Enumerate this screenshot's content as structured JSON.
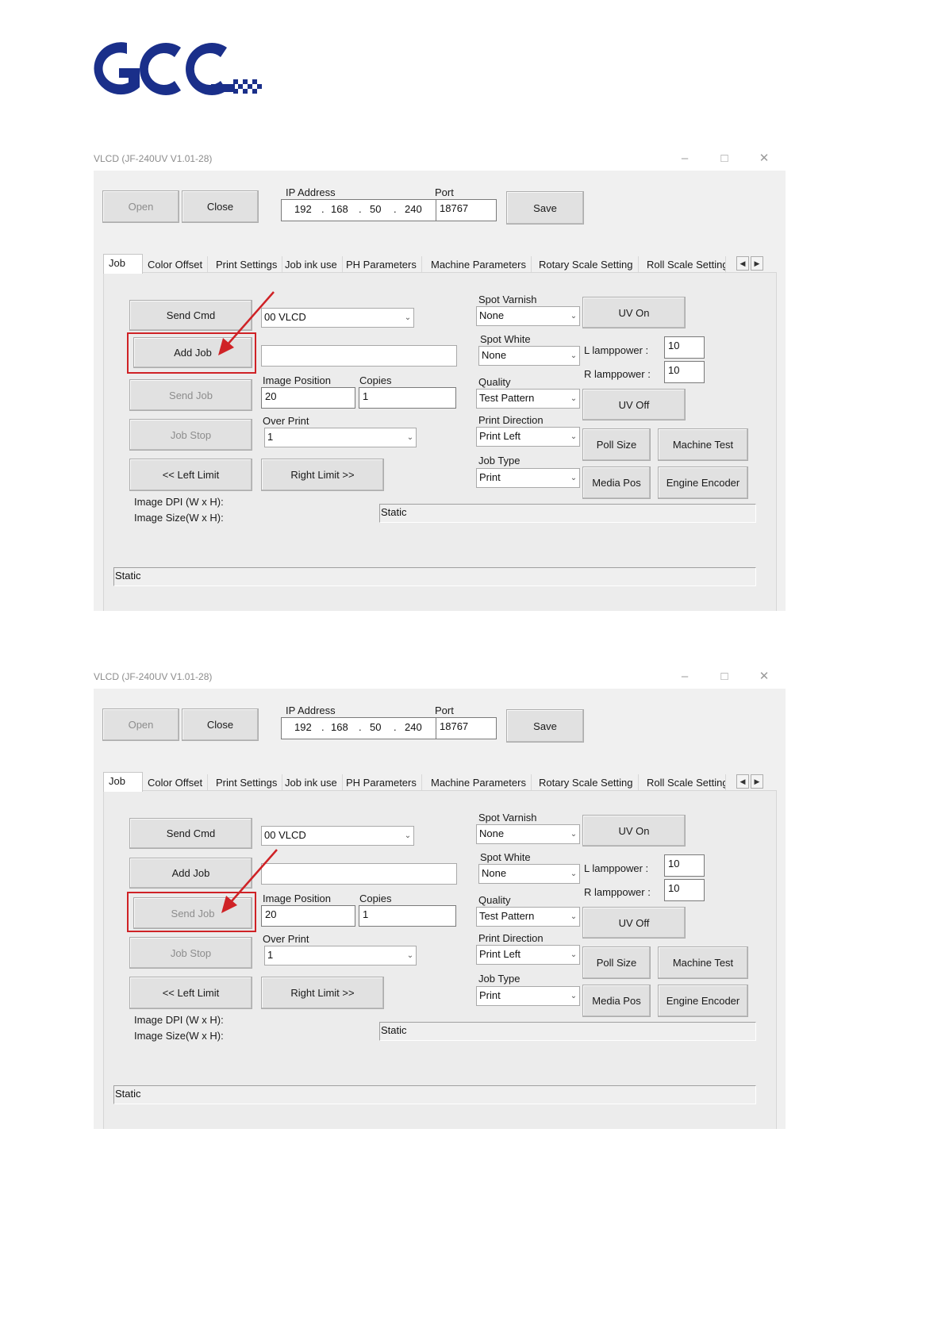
{
  "logo": {
    "text": "GCC",
    "color": "#1a2f8a"
  },
  "screens": [
    {
      "title": "VLCD (JF-240UV V1.01-28)",
      "highlighted_button": "add-job",
      "ip_address": {
        "label": "IP Address",
        "octets": [
          "192",
          "168",
          "50",
          "240"
        ]
      },
      "port": {
        "label": "Port",
        "value": "18767"
      },
      "buttons": {
        "open": "Open",
        "close": "Close",
        "save": "Save"
      },
      "tabs": [
        "Job",
        "Color Offset",
        "Print Settings",
        "Job ink use",
        "PH Parameters",
        "Machine Parameters",
        "Rotary Scale Setting",
        "Roll Scale Setting"
      ],
      "job": {
        "send_cmd": "Send Cmd",
        "cmd_select": "00 VLCD",
        "add_job": "Add Job",
        "job_path": "",
        "send_job": "Send Job",
        "job_stop": "Job Stop",
        "left_limit": "<< Left Limit",
        "right_limit": "Right Limit >>",
        "image_position_label": "Image Position",
        "image_position": "20",
        "copies_label": "Copies",
        "copies": "1",
        "over_print_label": "Over Print",
        "over_print": "1",
        "image_dpi_label": "Image DPI (W x H):",
        "image_size_label": "Image Size(W x H):",
        "info_static": "Static",
        "spot_varnish_label": "Spot Varnish",
        "spot_varnish": "None",
        "spot_white_label": "Spot White",
        "spot_white": "None",
        "quality_label": "Quality",
        "quality": "Test Pattern",
        "print_direction_label": "Print Direction",
        "print_direction": "Print Left",
        "job_type_label": "Job Type",
        "job_type": "Print",
        "uv_on": "UV On",
        "uv_off": "UV Off",
        "l_lamppower_label": "L lamppower :",
        "l_lamppower": "10",
        "r_lamppower_label": "R lamppower :",
        "r_lamppower": "10",
        "poll_size": "Poll Size",
        "machine_test": "Machine Test",
        "media_pos": "Media Pos",
        "engine_encoder": "Engine Encoder",
        "status_static": "Static"
      }
    },
    {
      "title": "VLCD (JF-240UV V1.01-28)",
      "highlighted_button": "send-job",
      "ip_address": {
        "label": "IP Address",
        "octets": [
          "192",
          "168",
          "50",
          "240"
        ]
      },
      "port": {
        "label": "Port",
        "value": "18767"
      },
      "buttons": {
        "open": "Open",
        "close": "Close",
        "save": "Save"
      },
      "tabs": [
        "Job",
        "Color Offset",
        "Print Settings",
        "Job ink use",
        "PH Parameters",
        "Machine Parameters",
        "Rotary Scale Setting",
        "Roll Scale Setting"
      ],
      "job": {
        "send_cmd": "Send Cmd",
        "cmd_select": "00 VLCD",
        "add_job": "Add Job",
        "job_path": "",
        "send_job": "Send Job",
        "job_stop": "Job Stop",
        "left_limit": "<< Left Limit",
        "right_limit": "Right Limit >>",
        "image_position_label": "Image Position",
        "image_position": "20",
        "copies_label": "Copies",
        "copies": "1",
        "over_print_label": "Over Print",
        "over_print": "1",
        "image_dpi_label": "Image DPI (W x H):",
        "image_size_label": "Image Size(W x H):",
        "info_static": "Static",
        "spot_varnish_label": "Spot Varnish",
        "spot_varnish": "None",
        "spot_white_label": "Spot White",
        "spot_white": "None",
        "quality_label": "Quality",
        "quality": "Test Pattern",
        "print_direction_label": "Print Direction",
        "print_direction": "Print Left",
        "job_type_label": "Job Type",
        "job_type": "Print",
        "uv_on": "UV On",
        "uv_off": "UV Off",
        "l_lamppower_label": "L lamppower :",
        "l_lamppower": "10",
        "r_lamppower_label": "R lamppower :",
        "r_lamppower": "10",
        "poll_size": "Poll Size",
        "machine_test": "Machine Test",
        "media_pos": "Media Pos",
        "engine_encoder": "Engine Encoder",
        "status_static": "Static"
      }
    }
  ],
  "colors": {
    "highlight": "#cf2226",
    "dialog_bg": "#f0f0f0",
    "title_text": "#8c8c8c"
  }
}
